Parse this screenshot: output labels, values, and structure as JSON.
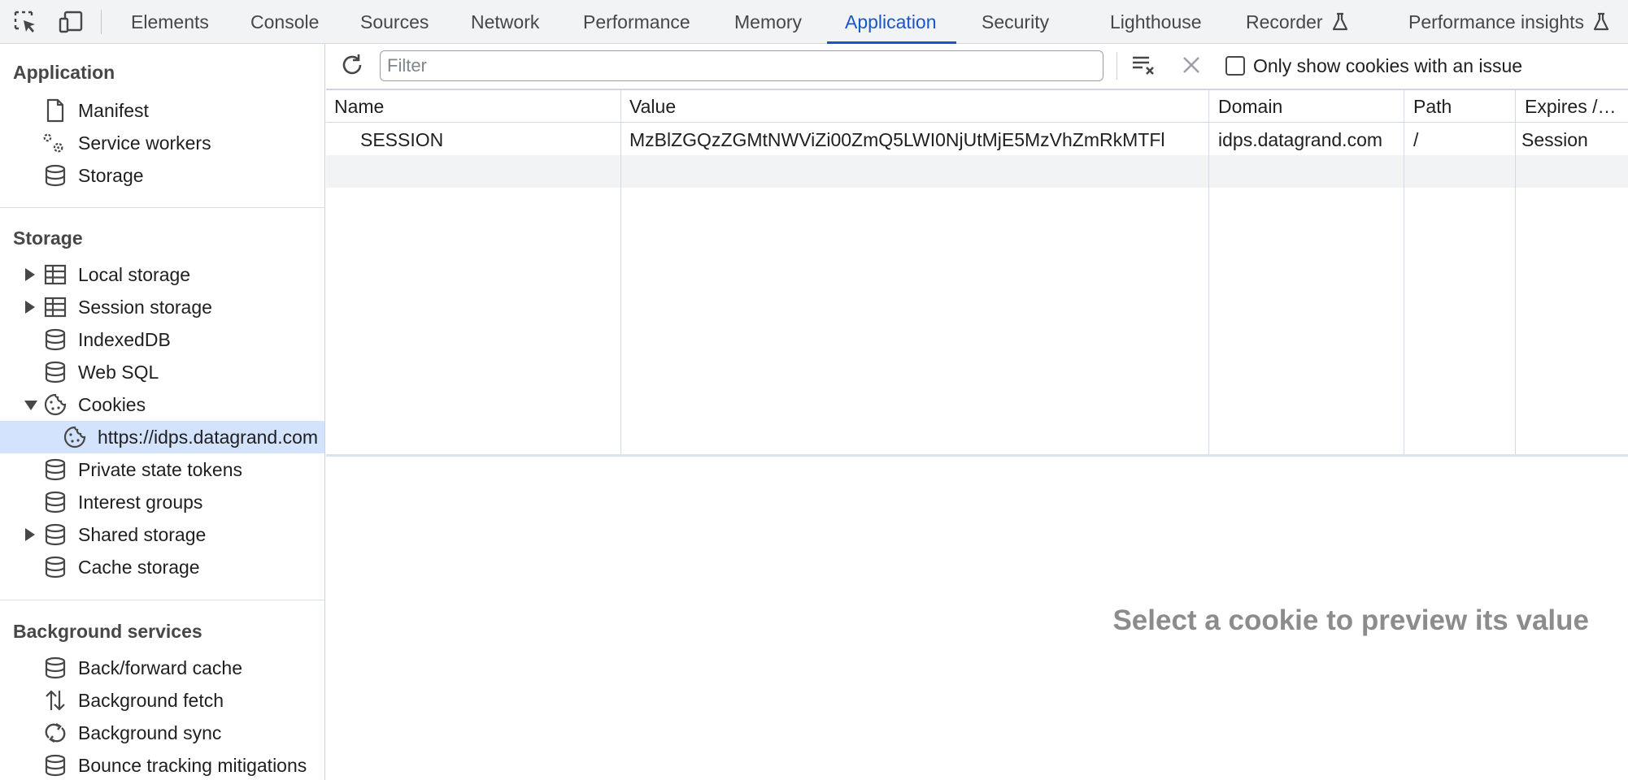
{
  "topbar": {
    "tabs": [
      {
        "label": "Elements"
      },
      {
        "label": "Console"
      },
      {
        "label": "Sources"
      },
      {
        "label": "Network"
      },
      {
        "label": "Performance"
      },
      {
        "label": "Memory"
      },
      {
        "label": "Application",
        "active": true
      },
      {
        "label": "Security"
      },
      {
        "label": "Lighthouse"
      },
      {
        "label": "Recorder",
        "icon": "flask-icon"
      },
      {
        "label": "Performance insights",
        "icon": "flask-icon"
      }
    ],
    "accent_color": "#1a56c7"
  },
  "sidebar": {
    "application": {
      "title": "Application",
      "items": [
        {
          "label": "Manifest",
          "icon": "file-icon"
        },
        {
          "label": "Service workers",
          "icon": "gears-icon"
        },
        {
          "label": "Storage",
          "icon": "database-icon"
        }
      ]
    },
    "storage": {
      "title": "Storage",
      "items": [
        {
          "label": "Local storage",
          "icon": "table-icon"
        },
        {
          "label": "Session storage",
          "icon": "table-icon"
        },
        {
          "label": "IndexedDB",
          "icon": "database-icon"
        },
        {
          "label": "Web SQL",
          "icon": "database-icon"
        },
        {
          "label": "Cookies",
          "icon": "cookie-icon"
        },
        {
          "label": "https://idps.datagrand.com",
          "icon": "cookie-icon",
          "selected": true
        },
        {
          "label": "Private state tokens",
          "icon": "database-icon"
        },
        {
          "label": "Interest groups",
          "icon": "database-icon"
        },
        {
          "label": "Shared storage",
          "icon": "database-icon"
        },
        {
          "label": "Cache storage",
          "icon": "database-icon"
        }
      ]
    },
    "background": {
      "title": "Background services",
      "items": [
        {
          "label": "Back/forward cache",
          "icon": "database-icon"
        },
        {
          "label": "Background fetch",
          "icon": "up-down-arrows-icon"
        },
        {
          "label": "Background sync",
          "icon": "sync-icon"
        },
        {
          "label": "Bounce tracking mitigations",
          "icon": "database-icon"
        }
      ]
    },
    "selected_color": "#d3e3fd"
  },
  "cookies": {
    "toolbar": {
      "filter_placeholder": "Filter",
      "filter_value": "",
      "only_issues_label": "Only show cookies with an issue",
      "only_issues_checked": false
    },
    "columns": [
      "Name",
      "Value",
      "Domain",
      "Path",
      "Expires /…"
    ],
    "rows": [
      {
        "name": "SESSION",
        "value": "MzBlZGQzZGMtNWViZi00ZmQ5LWI0NjUtMjE5MzVhZmRkMTFl",
        "domain": "idps.datagrand.com",
        "path": "/",
        "expires": "Session"
      }
    ],
    "preview_message": "Select a cookie to preview its value"
  }
}
